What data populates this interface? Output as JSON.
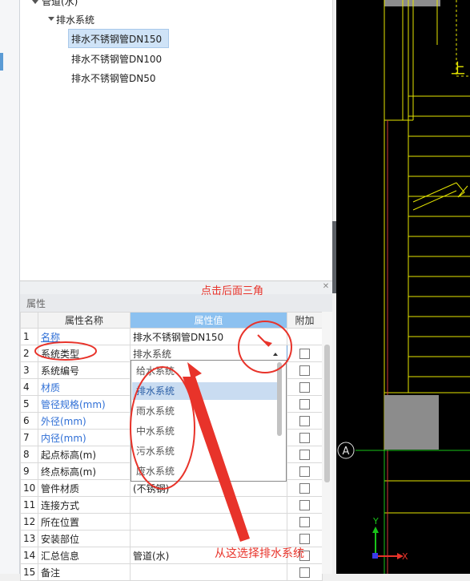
{
  "tree": {
    "partial_top": "管道(水)",
    "system_node": "排水系统",
    "items": [
      "排水不锈钢管DN150",
      "排水不锈钢管DN100",
      "排水不锈钢管DN50"
    ]
  },
  "props": {
    "panel_title": "属性",
    "headers": {
      "name": "属性名称",
      "value": "属性值",
      "extra": "附加"
    },
    "rows": [
      {
        "num": "1",
        "name": "名称",
        "value": "排水不锈钢管DN150"
      },
      {
        "num": "2",
        "name": "系统类型",
        "value": "排水系统"
      },
      {
        "num": "3",
        "name": "系统编号",
        "value": ""
      },
      {
        "num": "4",
        "name": "材质",
        "value": ""
      },
      {
        "num": "5",
        "name": "管径规格(mm)",
        "value": ""
      },
      {
        "num": "6",
        "name": "外径(mm)",
        "value": ""
      },
      {
        "num": "7",
        "name": "内径(mm)",
        "value": ""
      },
      {
        "num": "8",
        "name": "起点标高(m)",
        "value": ""
      },
      {
        "num": "9",
        "name": "终点标高(m)",
        "value": ""
      },
      {
        "num": "10",
        "name": "管件材质",
        "value": "(不锈钢)"
      },
      {
        "num": "11",
        "name": "连接方式",
        "value": ""
      },
      {
        "num": "12",
        "name": "所在位置",
        "value": ""
      },
      {
        "num": "13",
        "name": "安装部位",
        "value": ""
      },
      {
        "num": "14",
        "name": "汇总信息",
        "value": "管道(水)"
      },
      {
        "num": "15",
        "name": "备注",
        "value": ""
      }
    ]
  },
  "dropdown": {
    "options": [
      "给水系统",
      "排水系统",
      "雨水系统",
      "中水系统",
      "污水系统",
      "废水系统"
    ],
    "selected": "排水系统"
  },
  "annotations": {
    "click_triangle": "点击后面三角",
    "select_here": "从这选择排水系统"
  },
  "cad": {
    "axis_label": "A",
    "y_label": "Y",
    "x_label": "X",
    "text_up": "上"
  },
  "colors": {
    "annotation": "#e8332a",
    "selection": "#cfe3f7",
    "value_header": "#8cc1f0",
    "link_blue": "#2f6fd6",
    "cad_yellow": "#e6e600",
    "cad_green": "#19c419"
  }
}
